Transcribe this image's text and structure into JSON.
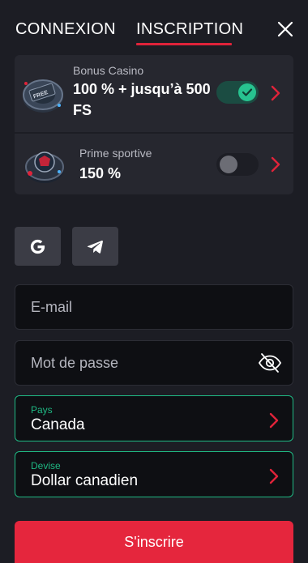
{
  "tabs": {
    "login": "CONNEXION",
    "register": "INSCRIPTION",
    "active": "register"
  },
  "bonuses": [
    {
      "subtitle": "Bonus Casino",
      "title": "100 % + jusqu’à 500 FS",
      "enabled": true,
      "image_icon": "casino-chip-icon"
    },
    {
      "subtitle": "Prime sportive",
      "title": "150 %",
      "enabled": false,
      "image_icon": "sports-chip-icon"
    }
  ],
  "social": [
    {
      "name": "google",
      "icon": "google-icon"
    },
    {
      "name": "telegram",
      "icon": "telegram-icon"
    }
  ],
  "form": {
    "email_placeholder": "E-mail",
    "password_placeholder": "Mot de passe",
    "country_label": "Pays",
    "country_value": "Canada",
    "currency_label": "Devise",
    "currency_value": "Dollar canadien",
    "submit_label": "S'inscrire"
  },
  "colors": {
    "accent_red": "#e0233a",
    "accent_green": "#1fb883",
    "background": "#1c1d24",
    "card": "#26272f"
  }
}
